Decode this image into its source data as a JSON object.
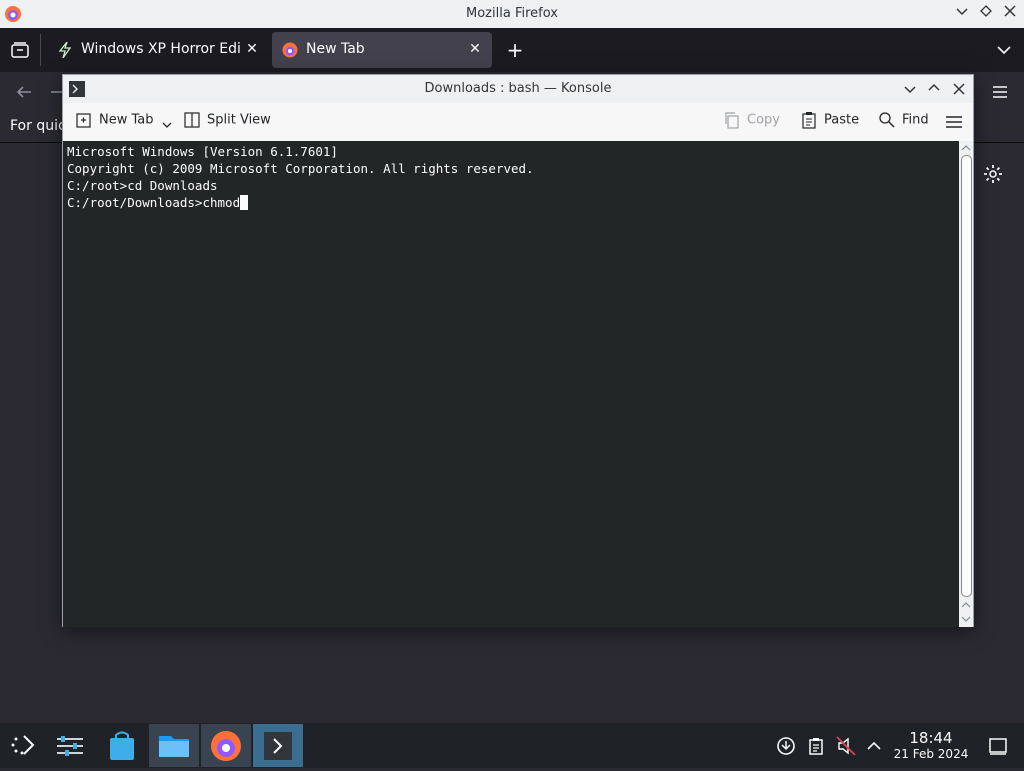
{
  "firefox": {
    "window_title": "Mozilla Firefox",
    "tabs": [
      {
        "label": "Windows XP Horror Editi",
        "close": "✕"
      },
      {
        "label": "New Tab",
        "close": "✕"
      }
    ],
    "new_tab_symbol": "+",
    "bookmarks_hint": "For quic"
  },
  "konsole": {
    "window_title": "Downloads : bash — Konsole",
    "toolbar": {
      "new_tab": "New Tab",
      "split_view": "Split View",
      "copy": "Copy",
      "paste": "Paste",
      "find": "Find"
    },
    "terminal_lines": [
      "Microsoft Windows [Version 6.1.7601]",
      "Copyright (c) 2009 Microsoft Corporation. All rights reserved.",
      "",
      "C:/root>cd Downloads",
      "C:/root/Downloads>chmod"
    ]
  },
  "taskbar": {
    "time": "18:44",
    "date": "21 Feb 2024"
  },
  "colors": {
    "terminal_bg": "#232627",
    "terminal_fg": "#fcfcfc",
    "taskbar_bg": "#1f2226",
    "active_task": "#3a6d8f"
  }
}
